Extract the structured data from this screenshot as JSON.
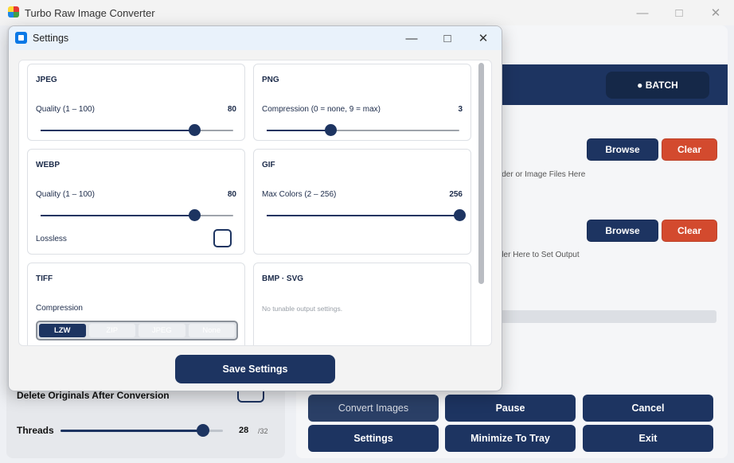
{
  "app": {
    "title": "Turbo Raw Image Converter"
  },
  "mode": {
    "batch_label": "● BATCH"
  },
  "input": {
    "browse_label": "Browse",
    "clear_label": "Clear",
    "hint": "lder or Image Files Here"
  },
  "output": {
    "browse_label": "Browse",
    "clear_label": "Clear",
    "hint": "der Here to Set Output"
  },
  "options": {
    "delete_label": "Delete Originals After Conversion",
    "threads_label": "Threads",
    "threads_value": "28",
    "threads_max": "/32",
    "threads_fraction": 0.875
  },
  "actions": {
    "convert": "Convert Images",
    "pause": "Pause",
    "cancel": "Cancel",
    "settings": "Settings",
    "minimize": "Minimize To Tray",
    "exit": "Exit"
  },
  "dialog": {
    "title": "Settings",
    "save_label": "Save Settings",
    "jpeg": {
      "title": "JPEG",
      "label": "Quality  (1 – 100)",
      "value": "80",
      "fraction": 0.8
    },
    "png": {
      "title": "PNG",
      "label": "Compression  (0 = none, 9 = max)",
      "value": "3",
      "fraction": 0.333
    },
    "webp": {
      "title": "WEBP",
      "label": "Quality  (1 – 100)",
      "value": "80",
      "fraction": 0.8,
      "lossless_label": "Lossless"
    },
    "gif": {
      "title": "GIF",
      "label": "Max Colors  (2 – 256)",
      "value": "256",
      "fraction": 1.0
    },
    "tiff": {
      "title": "TIFF",
      "label": "Compression",
      "options": [
        "LZW",
        "ZIP",
        "JPEG",
        "None"
      ],
      "selected": "LZW"
    },
    "bmp_svg": {
      "title": "BMP · SVG",
      "note": "No tunable output settings."
    }
  }
}
